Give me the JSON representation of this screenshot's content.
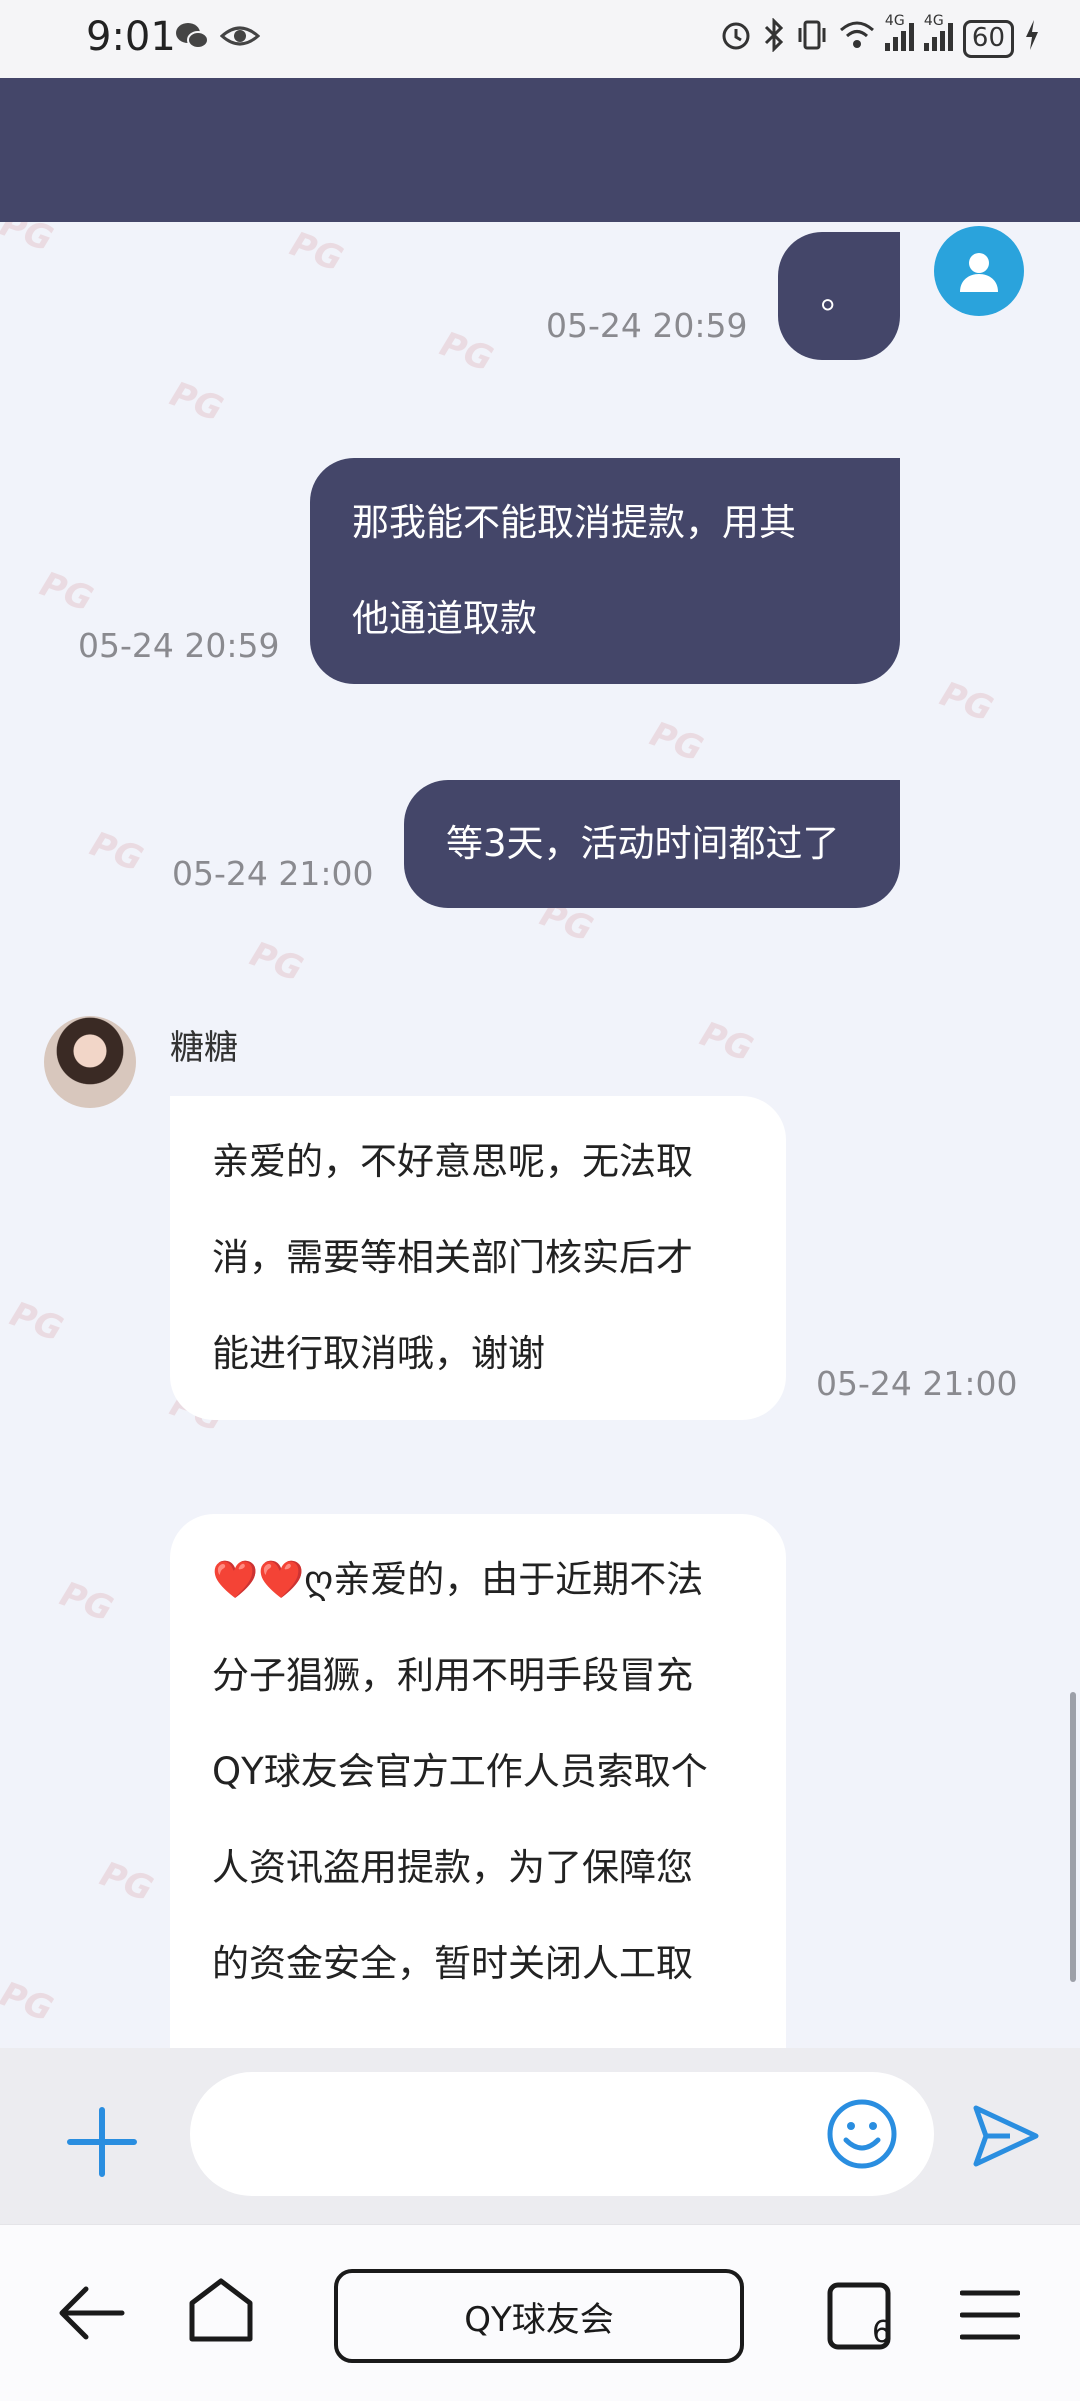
{
  "status_bar": {
    "time": "9:01",
    "left_icons": [
      "wechat-icon",
      "eye-icon"
    ],
    "right_icons": [
      "alarm-icon",
      "bluetooth-icon",
      "vibrate-icon",
      "wifi-icon",
      "signal-4g-icon",
      "signal-4g-icon"
    ],
    "network_label_1": "4G",
    "network_label_2": "4G",
    "battery": "60"
  },
  "messages": [
    {
      "type": "outgoing",
      "text": "。",
      "time": "05-24 20:59"
    },
    {
      "type": "outgoing",
      "lines": [
        "那我能不能取消提款，用其",
        "他通道取款"
      ],
      "time": "05-24 20:59"
    },
    {
      "type": "outgoing",
      "text": "等3天，活动时间都过了",
      "time": "05-24 21:00"
    },
    {
      "type": "incoming",
      "sender": "糖糖",
      "lines": [
        "亲爱的，不好意思呢，无法取",
        "消，需要等相关部门核实后才",
        "能进行取消哦，谢谢"
      ],
      "time": "05-24 21:00"
    },
    {
      "type": "incoming",
      "lines": [
        "❤️❤️ღ亲爱的，由于近期不法",
        "分子猖獗，利用不明手段冒充",
        "QY球友会官方工作人员索取个",
        "人资讯盗用提款，为了保障您",
        "的资金安全，暂时关闭人工取"
      ]
    }
  ],
  "watermark": "PG",
  "input": {
    "placeholder": "",
    "value": ""
  },
  "browser": {
    "url_label": "QY球友会",
    "tab_count": "6"
  },
  "colors": {
    "header": "#444669",
    "outgoing_bubble": "#444669",
    "accent": "#2a8ee0",
    "user_avatar": "#2aa3dc"
  }
}
